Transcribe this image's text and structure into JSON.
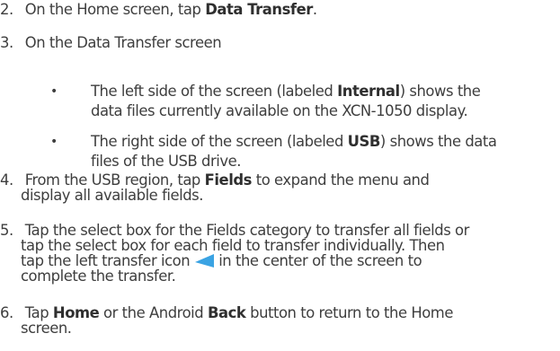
{
  "steps": [
    {
      "num": "2.",
      "pre": "On the Home screen, tap ",
      "bold": "Data Transfer",
      "post": "."
    },
    {
      "num": "3.",
      "text": "On the Data Transfer screen"
    },
    {
      "num": "4.",
      "pre": "From the USB region, tap ",
      "bold": "Fields",
      "post": " to expand the menu and",
      "line2": "display all available fields."
    },
    {
      "num": "5.",
      "line1": "Tap the select box for the Fields category to transfer all fields or",
      "line2": "tap the select box for each field  to transfer individually. Then",
      "line3_pre": "tap the left transfer icon",
      "line3_post": "in the center of the screen to",
      "line4": "complete the transfer."
    },
    {
      "num": "6.",
      "pre": "Tap ",
      "bold1": "Home",
      "mid": " or the Android ",
      "bold2": "Back",
      "post": " button to return to the Home",
      "line2": "screen."
    }
  ],
  "bullets": [
    {
      "dot": "•",
      "pre": "The left side of the screen (labeled ",
      "bold": "Internal",
      "post": ") shows the",
      "line2": "data files currently available on the XCN-1050 display."
    },
    {
      "dot": "•",
      "pre": "The right side of the screen (labeled ",
      "bold": "USB",
      "post": ") shows the data",
      "line2": "files of the USB drive."
    }
  ],
  "icons": {
    "transfer_arrow": "left-transfer-arrow-icon",
    "transfer_arrow_color": "#3aa3e3"
  }
}
